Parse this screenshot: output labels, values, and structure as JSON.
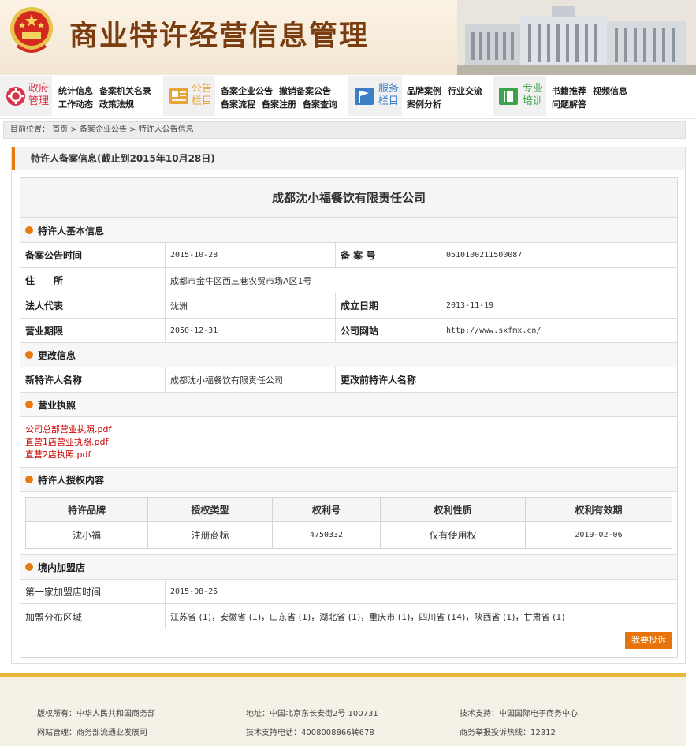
{
  "header": {
    "site_title": "商业特许经营信息管理"
  },
  "nav": {
    "groups": [
      {
        "category": "政府管理",
        "category_lines": [
          "政府",
          "管理"
        ],
        "links": [
          "统计信息",
          "备案机关名录",
          "工作动态",
          "政策法规"
        ]
      },
      {
        "category": "公告栏目",
        "category_lines": [
          "公告",
          "栏目"
        ],
        "links": [
          "备案企业公告",
          "撤销备案公告",
          "备案流程",
          "备案注册",
          "备案查询"
        ]
      },
      {
        "category": "服务栏目",
        "category_lines": [
          "服务",
          "栏目"
        ],
        "links": [
          "品牌案例",
          "行业交流",
          "案例分析"
        ]
      },
      {
        "category": "专业培训",
        "category_lines": [
          "专业",
          "培训"
        ],
        "links": [
          "书籍推荐",
          "视频信息",
          "问题解答"
        ]
      }
    ]
  },
  "breadcrumb": {
    "prefix": "目前位置：",
    "items": [
      "首页",
      "备案企业公告",
      "特许人公告信息"
    ],
    "sep": ">"
  },
  "panel": {
    "title": "特许人备案信息(截止到2015年10月28日)"
  },
  "company_name": "成都沈小福餐饮有限责任公司",
  "basic": {
    "section_title": "特许人基本信息",
    "announce_time_label": "备案公告时间",
    "announce_time": "2015-10-28",
    "record_no_label": "备 案 号",
    "record_no": "0510100211500087",
    "address_label": "住　　所",
    "address": "成都市金牛区西三巷农贸市场A区1号",
    "legal_rep_label": "法人代表",
    "legal_rep": "沈洲",
    "founded_label": "成立日期",
    "founded": "2013-11-19",
    "term_label": "营业期限",
    "term": "2050-12-31",
    "website_label": "公司网站",
    "website": "http://www.sxfmx.cn/"
  },
  "change": {
    "section_title": "更改信息",
    "new_name_label": "新特许人名称",
    "new_name": "成都沈小福餐饮有限责任公司",
    "old_name_label": "更改前特许人名称",
    "old_name": ""
  },
  "license": {
    "section_title": "营业执照",
    "files": [
      "公司总部营业执照.pdf",
      "直营1店营业执照.pdf",
      "直营2店执照.pdf"
    ]
  },
  "authorization": {
    "section_title": "特许人授权内容",
    "headers": [
      "特许品牌",
      "授权类型",
      "权利号",
      "权利性质",
      "权利有效期"
    ],
    "rows": [
      [
        "沈小福",
        "注册商标",
        "4750332",
        "仅有使用权",
        "2019-02-06"
      ]
    ]
  },
  "franchise": {
    "section_title": "境内加盟店",
    "first_time_label": "第一家加盟店时间",
    "first_time": "2015-08-25",
    "distribution_label": "加盟分布区域",
    "distribution": "江苏省 (1)，安徽省 (1)，山东省 (1)，湖北省 (1)，重庆市 (1)，四川省 (14)，陕西省 (1)，甘肃省 (1)"
  },
  "complain_button": "我要投诉",
  "footer": {
    "copyright": "版权所有：中华人民共和国商务部",
    "address": "地址：中国北京东长安街2号 100731",
    "tech_support": "技术支持：中国国际电子商务中心",
    "site_manager": "网站管理：商务部流通业发展司",
    "tech_phone": "技术支持电话：4008008866转678",
    "report_hotline": "商务举报投诉热线：12312"
  },
  "colors": {
    "accent": "#e87a11",
    "title_brown": "#7b3d10",
    "file_red": "#cc0000",
    "footer_line": "#e9b53a"
  }
}
